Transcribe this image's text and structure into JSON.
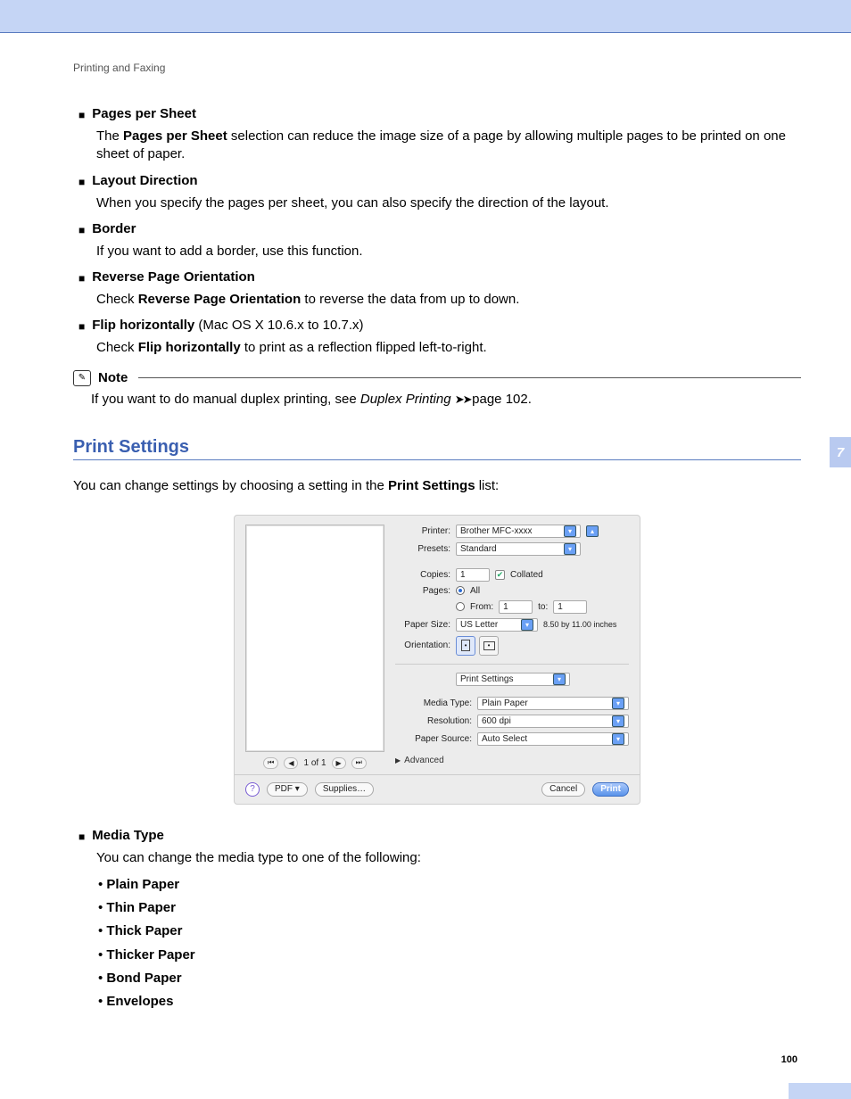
{
  "breadcrumb": "Printing and Faxing",
  "features": [
    {
      "title": "Pages per Sheet",
      "bold_ref": "Pages per Sheet",
      "body_tail": " selection can reduce the image size of a page by allowing multiple pages to be printed on one sheet of paper."
    },
    {
      "title": "Layout Direction",
      "body": "When you specify the pages per sheet, you can also specify the direction of the layout."
    },
    {
      "title": "Border",
      "body": "If you want to add a border, use this function."
    },
    {
      "title": "Reverse Page Orientation",
      "bold_ref": "Reverse Page Orientation",
      "body_tail": " to reverse the data from up to down."
    },
    {
      "title": "Flip horizontally",
      "title_suffix": "(Mac OS X 10.6.x to 10.7.x)",
      "bold_ref": "Flip horizontally",
      "body_tail": " to print as a reflection flipped left-to-right."
    }
  ],
  "note": {
    "title": "Note",
    "body_pre": "If you want to do manual duplex printing, see ",
    "link_text": "Duplex Printing",
    "body_post": "page 102."
  },
  "section": {
    "heading": "Print Settings",
    "lead_pre": "You can change settings by choosing a setting in the ",
    "lead_bold": "Print Settings",
    "lead_post": " list:"
  },
  "dialog": {
    "pager": "1 of 1",
    "labels": {
      "printer": "Printer:",
      "presets": "Presets:",
      "copies": "Copies:",
      "collated": "Collated",
      "pages": "Pages:",
      "all": "All",
      "from": "From:",
      "to": "to:",
      "paper_size": "Paper Size:",
      "orientation": "Orientation:",
      "media_type": "Media Type:",
      "resolution": "Resolution:",
      "paper_source": "Paper Source:",
      "advanced": "Advanced"
    },
    "values": {
      "printer": "Brother MFC-xxxx",
      "presets": "Standard",
      "copies": "1",
      "from": "1",
      "to": "1",
      "paper_size": "US Letter",
      "paper_dims": "8.50 by 11.00 inches",
      "panel": "Print Settings",
      "media_type": "Plain Paper",
      "resolution": "600 dpi",
      "paper_source": "Auto Select"
    },
    "buttons": {
      "pdf": "PDF ▾",
      "supplies": "Supplies…",
      "cancel": "Cancel",
      "print": "Print"
    }
  },
  "media_type": {
    "heading": "Media Type",
    "lead": "You can change the media type to one of the following:",
    "options": [
      "Plain Paper",
      "Thin Paper",
      "Thick Paper",
      "Thicker Paper",
      "Bond Paper",
      "Envelopes"
    ]
  },
  "chapter_tab": "7",
  "page_number": "100"
}
